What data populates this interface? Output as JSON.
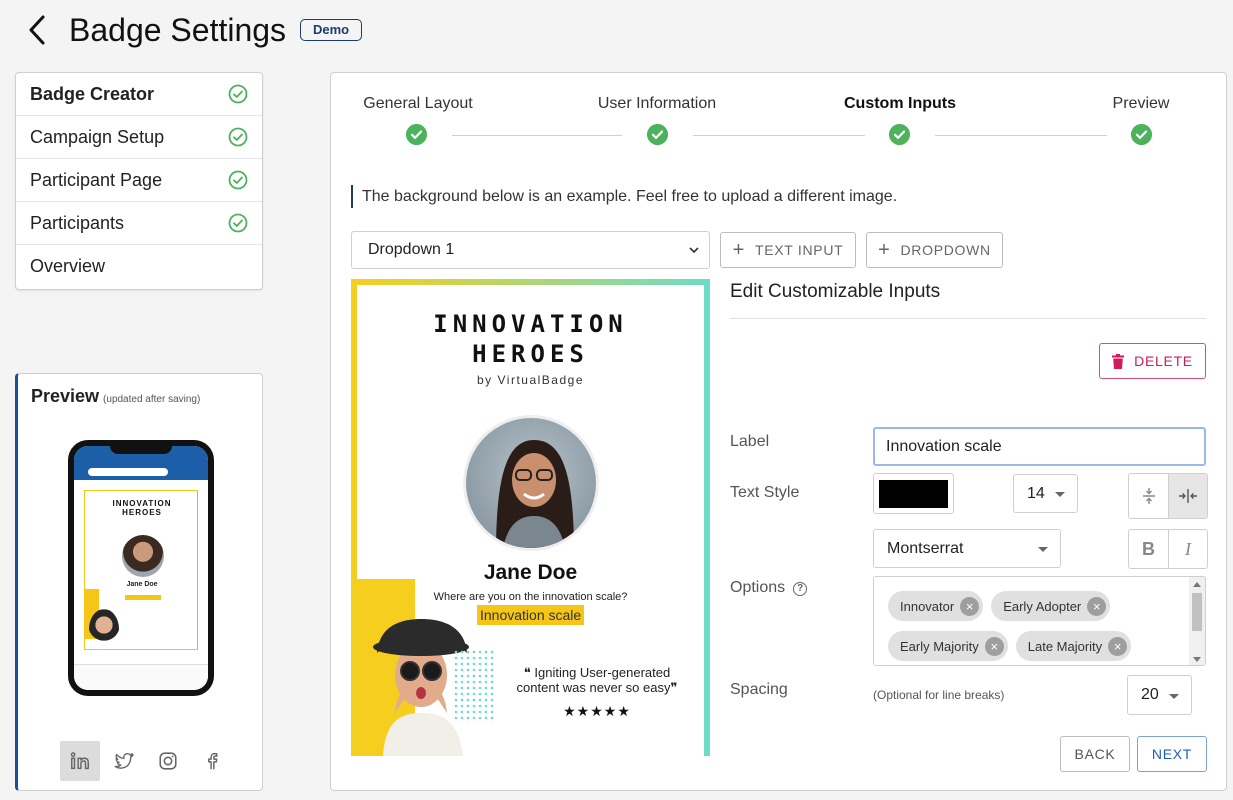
{
  "header": {
    "title": "Badge Settings",
    "badge": "Demo"
  },
  "sidebar": {
    "items": [
      {
        "label": "Badge Creator",
        "complete": true,
        "active": true
      },
      {
        "label": "Campaign Setup",
        "complete": true
      },
      {
        "label": "Participant Page",
        "complete": true
      },
      {
        "label": "Participants",
        "complete": true
      },
      {
        "label": "Overview",
        "complete": false
      }
    ]
  },
  "preview": {
    "title": "Preview",
    "note": "(updated after saving)",
    "phone_badge": {
      "title_line1": "INNOVATION",
      "title_line2": "HEROES",
      "name": "Jane Doe"
    },
    "social": [
      "linkedin-icon",
      "twitter-icon",
      "instagram-icon",
      "facebook-icon"
    ]
  },
  "steps": [
    {
      "label": "General Layout"
    },
    {
      "label": "User Information"
    },
    {
      "label": "Custom Inputs",
      "current": true
    },
    {
      "label": "Preview"
    }
  ],
  "info_text": "The background below is an example. Feel free to upload a different image.",
  "toolbar": {
    "dropdown_value": "Dropdown 1",
    "text_input_label": "TEXT INPUT",
    "dropdown_label": "DROPDOWN"
  },
  "badge": {
    "title_line1": "INNOVATION",
    "title_line2": "HEROES",
    "subtitle": "by VirtualBadge",
    "name": "Jane Doe",
    "question": "Where are you on the innovation scale?",
    "highlight": "Innovation scale",
    "quote_line1": "❝ Igniting User-generated",
    "quote_line2": "content was never so easy❞",
    "stars": "★★★★★",
    "colors": {
      "yellow": "#f6cf1e",
      "teal": "#6bdcc6"
    }
  },
  "editor": {
    "title": "Edit Customizable Inputs",
    "delete_label": "DELETE",
    "label_label": "Label",
    "label_value": "Innovation scale",
    "text_style_label": "Text Style",
    "text_color": "#000000",
    "font_size": "14",
    "font_family": "Montserrat",
    "format_bold": "B",
    "format_italic": "I",
    "options_label": "Options",
    "options": [
      "Innovator",
      "Early Adopter",
      "Early Majority",
      "Late Majority"
    ],
    "spacing_label": "Spacing",
    "spacing_hint": "(Optional for line breaks)",
    "spacing_value": "20",
    "help_glyph": "?"
  },
  "footer": {
    "back_label": "BACK",
    "next_label": "NEXT"
  }
}
